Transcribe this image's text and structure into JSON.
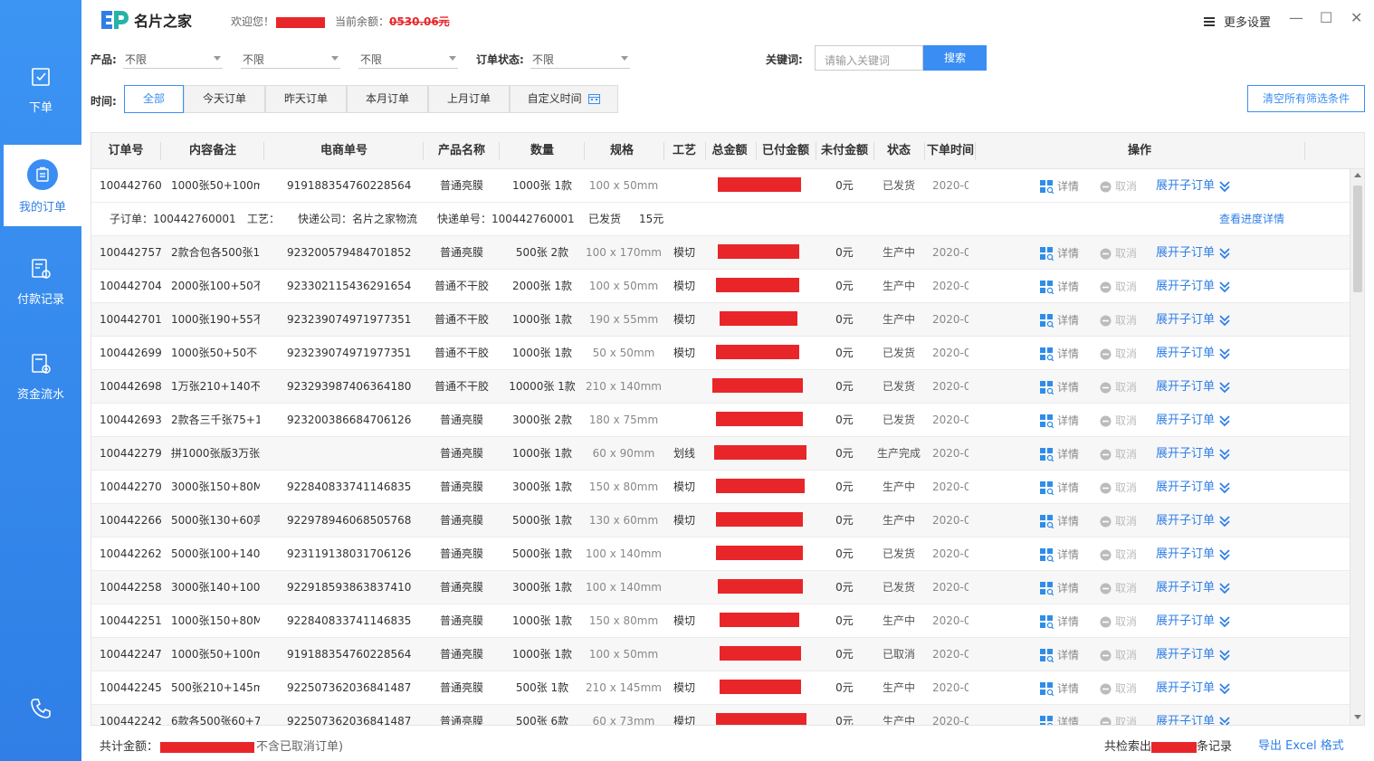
{
  "app": {
    "logo_text": "名片之家"
  },
  "header": {
    "welcome_label": "欢迎您！",
    "balance_label": "当前余额：",
    "balance_value": "0530.06元",
    "more_settings": "更多设置",
    "minimize": "—",
    "maximize": "☐",
    "close": "✕"
  },
  "sidebar": {
    "items": [
      {
        "label": "下单",
        "icon": "order-icon"
      },
      {
        "label": "我的订单",
        "icon": "my-orders-icon"
      },
      {
        "label": "付款记录",
        "icon": "payment-record-icon"
      },
      {
        "label": "资金流水",
        "icon": "fund-flow-icon"
      }
    ],
    "phone_icon": "phone-icon"
  },
  "filters": {
    "product_label": "产品:",
    "product_1": "不限",
    "product_2": "不限",
    "product_3": "不限",
    "status_label": "订单状态:",
    "status_value": "不限",
    "keyword_label": "关键词:",
    "keyword_placeholder": "请输入关键词",
    "search_button": "搜索"
  },
  "time_filter": {
    "label": "时间:",
    "buttons": [
      "全部",
      "今天订单",
      "昨天订单",
      "本月订单",
      "上月订单",
      "自定义时间"
    ],
    "clear_button": "清空所有筛选条件"
  },
  "table": {
    "headers": [
      "订单号",
      "内容备注",
      "电商单号",
      "产品名称",
      "数量",
      "规格",
      "工艺",
      "总金额",
      "已付金额",
      "未付金额",
      "状态",
      "下单时间",
      "操作"
    ],
    "op_detail": "详情",
    "op_cancel": "取消",
    "op_expand": "展开子订单",
    "rows": [
      {
        "id": "100442760",
        "note": "1000张50+100m",
        "ec": "919188354760228564",
        "product": "普通亮膜",
        "qty": "1000张 1款",
        "spec": "100 x 50mm",
        "craft": "",
        "unpaid": "0元",
        "status": "已发货",
        "time": "2020-0"
      },
      {
        "id": "100442757",
        "note": "2款合包各500张1",
        "ec": "923200579484701852",
        "product": "普通亮膜",
        "qty": "500张 2款",
        "spec": "100 x 170mm",
        "craft": "模切",
        "unpaid": "0元",
        "status": "生产中",
        "time": "2020-0"
      },
      {
        "id": "100442704",
        "note": "2000张100+50不",
        "ec": "923302115436291654",
        "product": "普通不干胶",
        "qty": "2000张 1款",
        "spec": "100 x 50mm",
        "craft": "模切",
        "unpaid": "0元",
        "status": "生产中",
        "time": "2020-0"
      },
      {
        "id": "100442701",
        "note": "1000张190+55不",
        "ec": "923239074971977351",
        "product": "普通不干胶",
        "qty": "1000张 1款",
        "spec": "190 x 55mm",
        "craft": "模切",
        "unpaid": "0元",
        "status": "生产中",
        "time": "2020-0"
      },
      {
        "id": "100442699",
        "note": "1000张50+50不",
        "ec": "923239074971977351",
        "product": "普通不干胶",
        "qty": "1000张 1款",
        "spec": "50 x 50mm",
        "craft": "模切",
        "unpaid": "0元",
        "status": "已发货",
        "time": "2020-0"
      },
      {
        "id": "100442698",
        "note": "1万张210+140不",
        "ec": "923293987406364180",
        "product": "普通不干胶",
        "qty": "10000张 1款",
        "spec": "210 x 140mm",
        "craft": "",
        "unpaid": "0元",
        "status": "已发货",
        "time": "2020-0"
      },
      {
        "id": "100442693",
        "note": "2款各三千张75+1",
        "ec": "923200386684706126",
        "product": "普通亮膜",
        "qty": "3000张 2款",
        "spec": "180 x 75mm",
        "craft": "",
        "unpaid": "0元",
        "status": "已发货",
        "time": "2020-0"
      },
      {
        "id": "100442279",
        "note": "拼1000张版3万张",
        "ec": "",
        "product": "普通亮膜",
        "qty": "1000张 1款",
        "spec": "60 x 90mm",
        "craft": "划线",
        "unpaid": "0元",
        "status": "生产完成",
        "time": "2020-0"
      },
      {
        "id": "100442270",
        "note": "3000张150+80M",
        "ec": "922840833741146835",
        "product": "普通亮膜",
        "qty": "3000张 1款",
        "spec": "150 x 80mm",
        "craft": "模切",
        "unpaid": "0元",
        "status": "生产中",
        "time": "2020-0"
      },
      {
        "id": "100442266",
        "note": "5000张130+60亮",
        "ec": "922978946068505768",
        "product": "普通亮膜",
        "qty": "5000张 1款",
        "spec": "130 x 60mm",
        "craft": "模切",
        "unpaid": "0元",
        "status": "生产中",
        "time": "2020-0"
      },
      {
        "id": "100442262",
        "note": "5000张100+140",
        "ec": "923119138031706126",
        "product": "普通亮膜",
        "qty": "5000张 1款",
        "spec": "100 x 140mm",
        "craft": "",
        "unpaid": "0元",
        "status": "已发货",
        "time": "2020-0"
      },
      {
        "id": "100442258",
        "note": "3000张140+100r",
        "ec": "922918593863837410",
        "product": "普通亮膜",
        "qty": "3000张 1款",
        "spec": "100 x 140mm",
        "craft": "",
        "unpaid": "0元",
        "status": "已发货",
        "time": "2020-0"
      },
      {
        "id": "100442251",
        "note": "1000张150+80M",
        "ec": "922840833741146835",
        "product": "普通亮膜",
        "qty": "1000张 1款",
        "spec": "150 x 80mm",
        "craft": "模切",
        "unpaid": "0元",
        "status": "生产中",
        "time": "2020-0"
      },
      {
        "id": "100442247",
        "note": "1000张50+100m",
        "ec": "919188354760228564",
        "product": "普通亮膜",
        "qty": "1000张 1款",
        "spec": "100 x 50mm",
        "craft": "",
        "unpaid": "0元",
        "status": "已取消",
        "time": "2020-0"
      },
      {
        "id": "100442245",
        "note": "500张210+145m",
        "ec": "922507362036841487",
        "product": "普通亮膜",
        "qty": "500张 1款",
        "spec": "210 x 145mm",
        "craft": "模切",
        "unpaid": "0元",
        "status": "生产中",
        "time": "2020-0"
      },
      {
        "id": "100442242",
        "note": "6款各500张60+7",
        "ec": "922507362036841487",
        "product": "普通亮膜",
        "qty": "500张 6款",
        "spec": "60 x 73mm",
        "craft": "模切",
        "unpaid": "0元",
        "status": "生产中",
        "time": "2020-0"
      }
    ],
    "sub_order": {
      "sub_label": "子订单：100442760001",
      "craft_label": "工艺：",
      "courier": "快递公司：名片之家物流",
      "tracking": "快递单号：100442760001",
      "status": "已发货",
      "amount": "15元",
      "progress_link": "查看进度详情"
    }
  },
  "footer": {
    "total_label": "共计金额：",
    "total_note": "不含已取消订单)",
    "count_prefix": "共检索出",
    "count_suffix": "条记录",
    "export": "导出 Excel 格式"
  },
  "colors": {
    "accent": "#3a8ef3",
    "sidebar": "#2f7fe6",
    "redact": "#e8262a"
  }
}
